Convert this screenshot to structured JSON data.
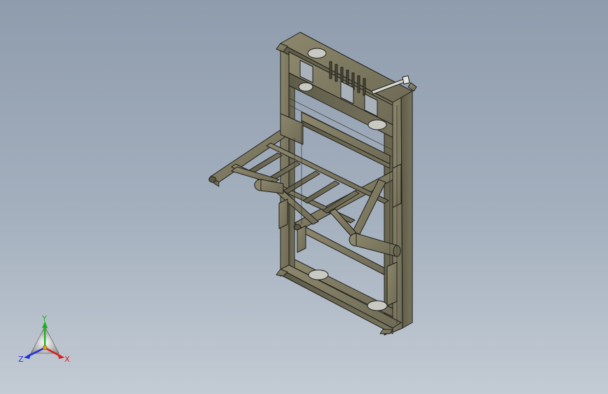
{
  "viewport": {
    "background_top": "#8f9cad",
    "background_bottom": "#c3cbd4"
  },
  "model": {
    "body_color": "#7f7b62",
    "edge_color": "#1e1e1a",
    "hole_color": "#c9c9c4"
  },
  "triad": {
    "x_label": "X",
    "y_label": "Y",
    "z_label": "Z",
    "x_color": "#d42020",
    "y_color": "#20b020",
    "z_color": "#2030d8"
  }
}
